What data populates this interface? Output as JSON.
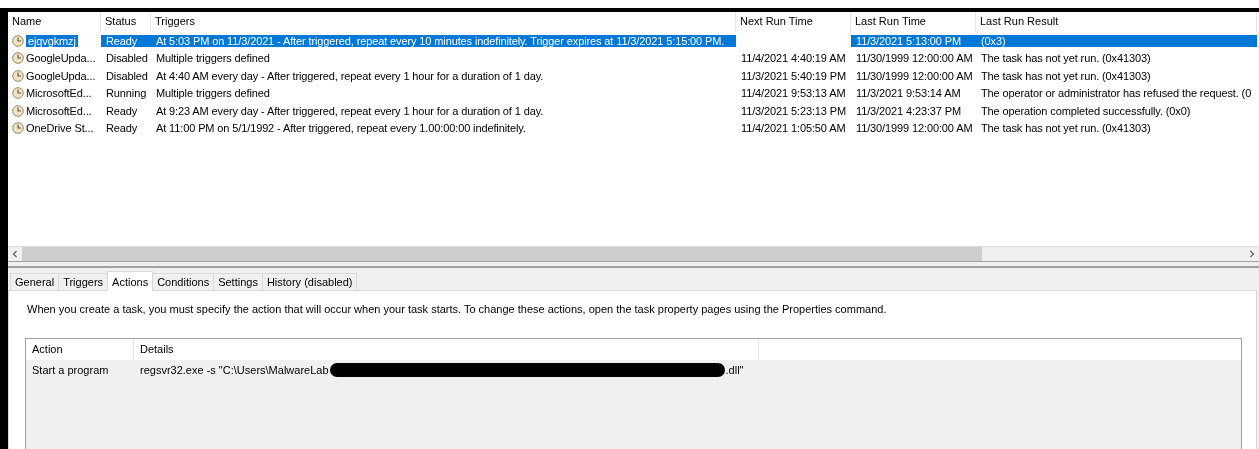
{
  "task_list": {
    "columns": [
      "Name",
      "Status",
      "Triggers",
      "Next Run Time",
      "Last Run Time",
      "Last Run Result"
    ],
    "rows": [
      {
        "name": "ejqvgkmzj",
        "status": "Ready",
        "triggers": "At 5:03 PM on 11/3/2021 - After triggered, repeat every 10 minutes indefinitely. Trigger expires at 11/3/2021 5:15:00 PM.",
        "next_run_time": "",
        "last_run_time": "11/3/2021 5:13:00 PM",
        "last_run_result": "(0x3)",
        "selected": true
      },
      {
        "name": "GoogleUpda...",
        "status": "Disabled",
        "triggers": "Multiple triggers defined",
        "next_run_time": "11/4/2021 4:40:19 AM",
        "last_run_time": "11/30/1999 12:00:00 AM",
        "last_run_result": "The task has not yet run. (0x41303)",
        "selected": false
      },
      {
        "name": "GoogleUpda...",
        "status": "Disabled",
        "triggers": "At 4:40 AM every day - After triggered, repeat every 1 hour for a duration of 1 day.",
        "next_run_time": "11/3/2021 5:40:19 PM",
        "last_run_time": "11/30/1999 12:00:00 AM",
        "last_run_result": "The task has not yet run. (0x41303)",
        "selected": false
      },
      {
        "name": "MicrosoftEd...",
        "status": "Running",
        "triggers": "Multiple triggers defined",
        "next_run_time": "11/4/2021 9:53:13 AM",
        "last_run_time": "11/3/2021 9:53:14 AM",
        "last_run_result": "The operator or administrator has refused the request. (0",
        "selected": false
      },
      {
        "name": "MicrosoftEd...",
        "status": "Ready",
        "triggers": "At 9:23 AM every day - After triggered, repeat every 1 hour for a duration of 1 day.",
        "next_run_time": "11/3/2021 5:23:13 PM",
        "last_run_time": "11/3/2021 4:23:37 PM",
        "last_run_result": "The operation completed successfully. (0x0)",
        "selected": false
      },
      {
        "name": "OneDrive St...",
        "status": "Ready",
        "triggers": "At 11:00 PM on 5/1/1992 - After triggered, repeat every 1.00:00:00 indefinitely.",
        "next_run_time": "11/4/2021 1:05:50 AM",
        "last_run_time": "11/30/1999 12:00:00 AM",
        "last_run_result": "The task has not yet run. (0x41303)",
        "selected": false
      }
    ]
  },
  "tabs": [
    {
      "label": "General",
      "selected": false
    },
    {
      "label": "Triggers",
      "selected": false
    },
    {
      "label": "Actions",
      "selected": true
    },
    {
      "label": "Conditions",
      "selected": false
    },
    {
      "label": "Settings",
      "selected": false
    },
    {
      "label": "History (disabled)",
      "selected": false
    }
  ],
  "description": "When you create a task, you must specify the action that will occur when your task starts.  To change these actions, open the task property pages using the Properties command.",
  "actions_table": {
    "columns": [
      "Action",
      "Details"
    ],
    "rows": [
      {
        "action": "Start a program",
        "details_before_redaction": "regsvr32.exe -s \"C:\\Users\\MalwareLab",
        "details_after_redaction": ".dll\""
      }
    ]
  }
}
